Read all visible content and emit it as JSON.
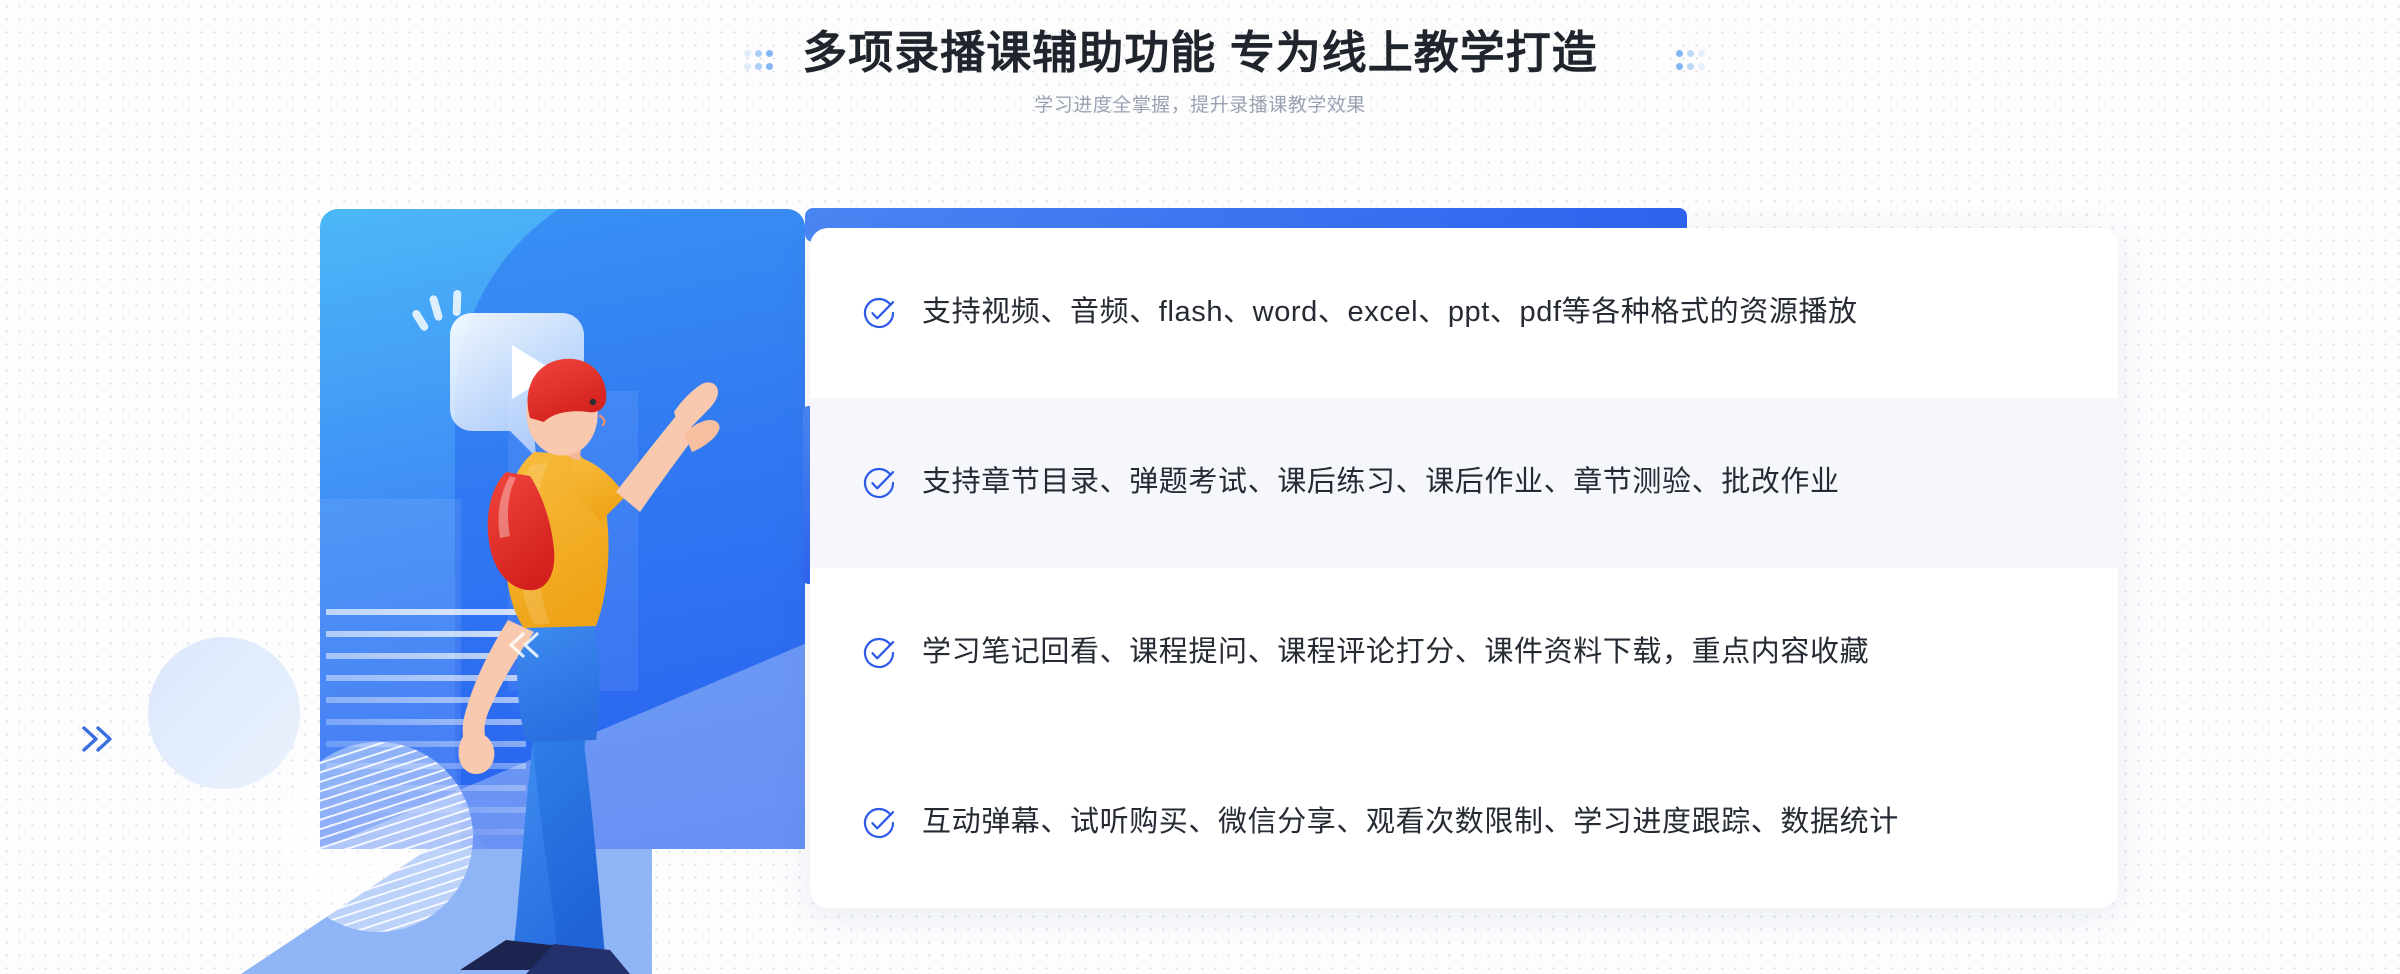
{
  "header": {
    "title": "多项录播课辅助功能 专为线上教学打造",
    "subtitle": "学习进度全掌握，提升录播课教学效果"
  },
  "ornaments": {
    "left_dots_label": "dot-grid-ornament",
    "right_dots_label": "dot-grid-ornament",
    "chevron_right_label": "chevron-double-right",
    "chevron_left_label": "chevron-double-left"
  },
  "illustration": {
    "alt": "woman pointing up at video play bubble",
    "play_bubble_label": "video-play-bubble",
    "panel_gradient_from": "#4cb8f7",
    "panel_gradient_to": "#2f63f0",
    "shirt_color": "#f5b12e",
    "hair_color": "#e8352f",
    "pants_color": "#2f7fe8",
    "shoe_color": "#1c2550",
    "skin_color": "#f8c9ae"
  },
  "features": {
    "active_index": 1,
    "check_icon_color": "#2b5ae8",
    "items": [
      {
        "icon": "check-circle-icon",
        "text": "支持视频、音频、flash、word、excel、ppt、pdf等各种格式的资源播放"
      },
      {
        "icon": "check-circle-icon",
        "text": "支持章节目录、弹题考试、课后练习、课后作业、章节测验、批改作业"
      },
      {
        "icon": "check-circle-icon",
        "text": "学习笔记回看、课程提问、课程评论打分、课件资料下载，重点内容收藏"
      },
      {
        "icon": "check-circle-icon",
        "text": "互动弹幕、试听购买、微信分享、观看次数限制、学习进度跟踪、数据统计"
      }
    ]
  },
  "colors": {
    "page_background": "#fdfdfe",
    "card_background": "#ffffff",
    "active_row_background": "#f5f7fc",
    "accent_blue": "#2f63f0",
    "title_color": "#20242c",
    "subtitle_color": "#9aa2b1",
    "body_text_color": "#262b33"
  }
}
